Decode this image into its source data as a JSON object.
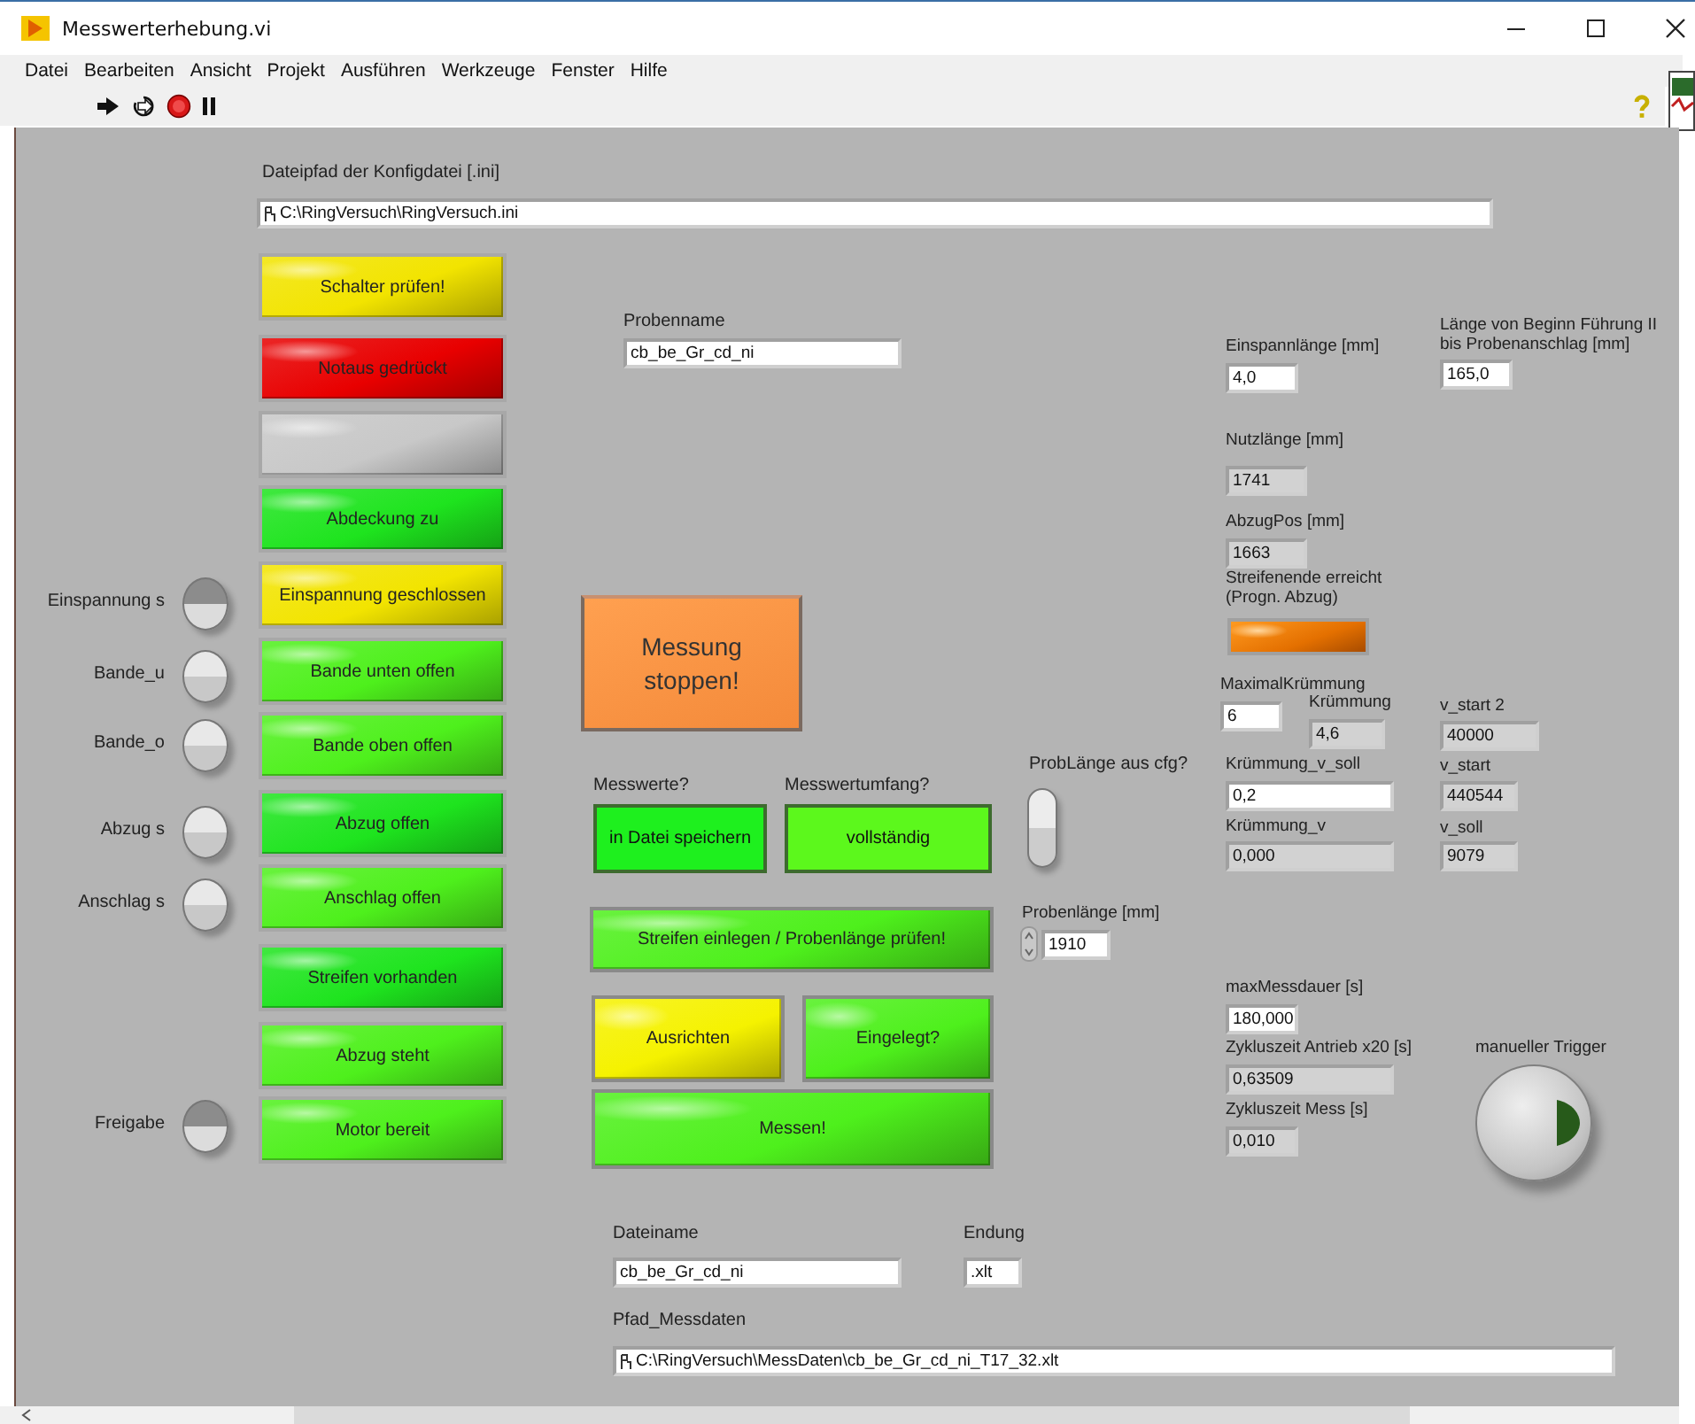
{
  "window": {
    "title": "Messwerterhebung.vi"
  },
  "menu": [
    "Datei",
    "Bearbeiten",
    "Ansicht",
    "Projekt",
    "Ausführen",
    "Werkzeuge",
    "Fenster",
    "Hilfe"
  ],
  "config_path": {
    "label": "Dateipfad der Konfigdatei [.ini]",
    "value": "C:\\RingVersuch\\RingVersuch.ini"
  },
  "status_lamps": [
    {
      "label": "Schalter prüfen!",
      "color": "#f2e400"
    },
    {
      "label": "Notaus gedrückt",
      "color": "#e80000"
    },
    {
      "color": "#c8c8c8"
    },
    {
      "label": "Abdeckung zu",
      "color": "#1ee41e"
    },
    {
      "label": "Einspannung geschlossen",
      "color": "#f2e400"
    },
    {
      "label": "Bande unten offen",
      "color": "#4ef01c"
    },
    {
      "label": "Bande oben offen",
      "color": "#4ef01c"
    },
    {
      "label": "Abzug offen",
      "color": "#1ee41e"
    },
    {
      "label": "Anschlag offen",
      "color": "#4ef01c"
    },
    {
      "label": "Streifen vorhanden",
      "color": "#1ee41e"
    },
    {
      "label": "Abzug steht",
      "color": "#4ef01c"
    },
    {
      "label": "Motor bereit",
      "color": "#4ef01c"
    }
  ],
  "switches": [
    {
      "label": "Einspannung s",
      "on": true
    },
    {
      "label": "Bande_u",
      "on": false
    },
    {
      "label": "Bande_o",
      "on": false
    },
    {
      "label": "Abzug s",
      "on": false
    },
    {
      "label": "Anschlag s",
      "on": false
    },
    {
      "label": "Freigabe",
      "on": true
    }
  ],
  "probenname": {
    "label": "Probenname",
    "value": "cb_be_Gr_cd_ni"
  },
  "stop_button": {
    "label": "Messung stoppen!"
  },
  "toggles": [
    {
      "label": "Messwerte?",
      "value": "in Datei speichern",
      "color": "#1ef01e"
    },
    {
      "label": "Messwertumfang?",
      "value": "vollständig",
      "color": "#5cf81c"
    }
  ],
  "problaenge_cfg": {
    "label": "ProbLänge aus cfg?",
    "on": false
  },
  "actions": [
    {
      "label": "Streifen einlegen / Probenlänge prüfen!",
      "color": "#4ef01c"
    },
    {
      "label": "Ausrichten",
      "color": "#f5f200"
    },
    {
      "label": "Eingelegt?",
      "color": "#4ef01c"
    },
    {
      "label": "Messen!",
      "color": "#4ef01c"
    }
  ],
  "probenlaenge": {
    "label": "Probenlänge [mm]",
    "value": "1910"
  },
  "numerics": [
    {
      "label": "Einspannlänge [mm]",
      "value": "4,0",
      "kind": "control"
    },
    {
      "label": "Länge von Beginn Führung II bis Probenanschlag [mm]",
      "value": "165,0",
      "kind": "control"
    },
    {
      "label": "Nutzlänge [mm]",
      "value": "1741",
      "kind": "indicator"
    },
    {
      "label": "AbzugPos [mm]",
      "value": "1663",
      "kind": "indicator"
    },
    {
      "label": "MaximalKrümmung",
      "value": "6",
      "kind": "control"
    },
    {
      "label": "Krümmung",
      "value": "4,6",
      "kind": "indicator"
    },
    {
      "label": "v_start 2",
      "value": "40000",
      "kind": "indicator"
    },
    {
      "label": "Krümmung_v_soll",
      "value": "0,2",
      "kind": "control"
    },
    {
      "label": "v_start",
      "value": "440544",
      "kind": "indicator"
    },
    {
      "label": "Krümmung_v",
      "value": "0,000",
      "kind": "indicator"
    },
    {
      "label": "v_soll",
      "value": "9079",
      "kind": "indicator"
    },
    {
      "label": "maxMessdauer [s]",
      "value": "180,000",
      "kind": "control"
    },
    {
      "label": "Zykluszeit Antrieb x20 [s]",
      "value": "0,63509",
      "kind": "indicator"
    },
    {
      "label": "Zykluszeit Mess [s]",
      "value": "0,010",
      "kind": "indicator"
    }
  ],
  "streifenende": {
    "label": "Streifenende erreicht (Progn. Abzug)",
    "on": true
  },
  "trigger": {
    "label": "manueller Trigger"
  },
  "files": [
    {
      "label": "Dateiname",
      "value": "cb_be_Gr_cd_ni",
      "kind": "text"
    },
    {
      "label": "Endung",
      "value": ".xlt",
      "kind": "text"
    },
    {
      "label": "Pfad_Messdaten",
      "value": "C:\\RingVersuch\\MessDaten\\cb_be_Gr_cd_ni_T17_32.xlt",
      "kind": "path"
    }
  ]
}
